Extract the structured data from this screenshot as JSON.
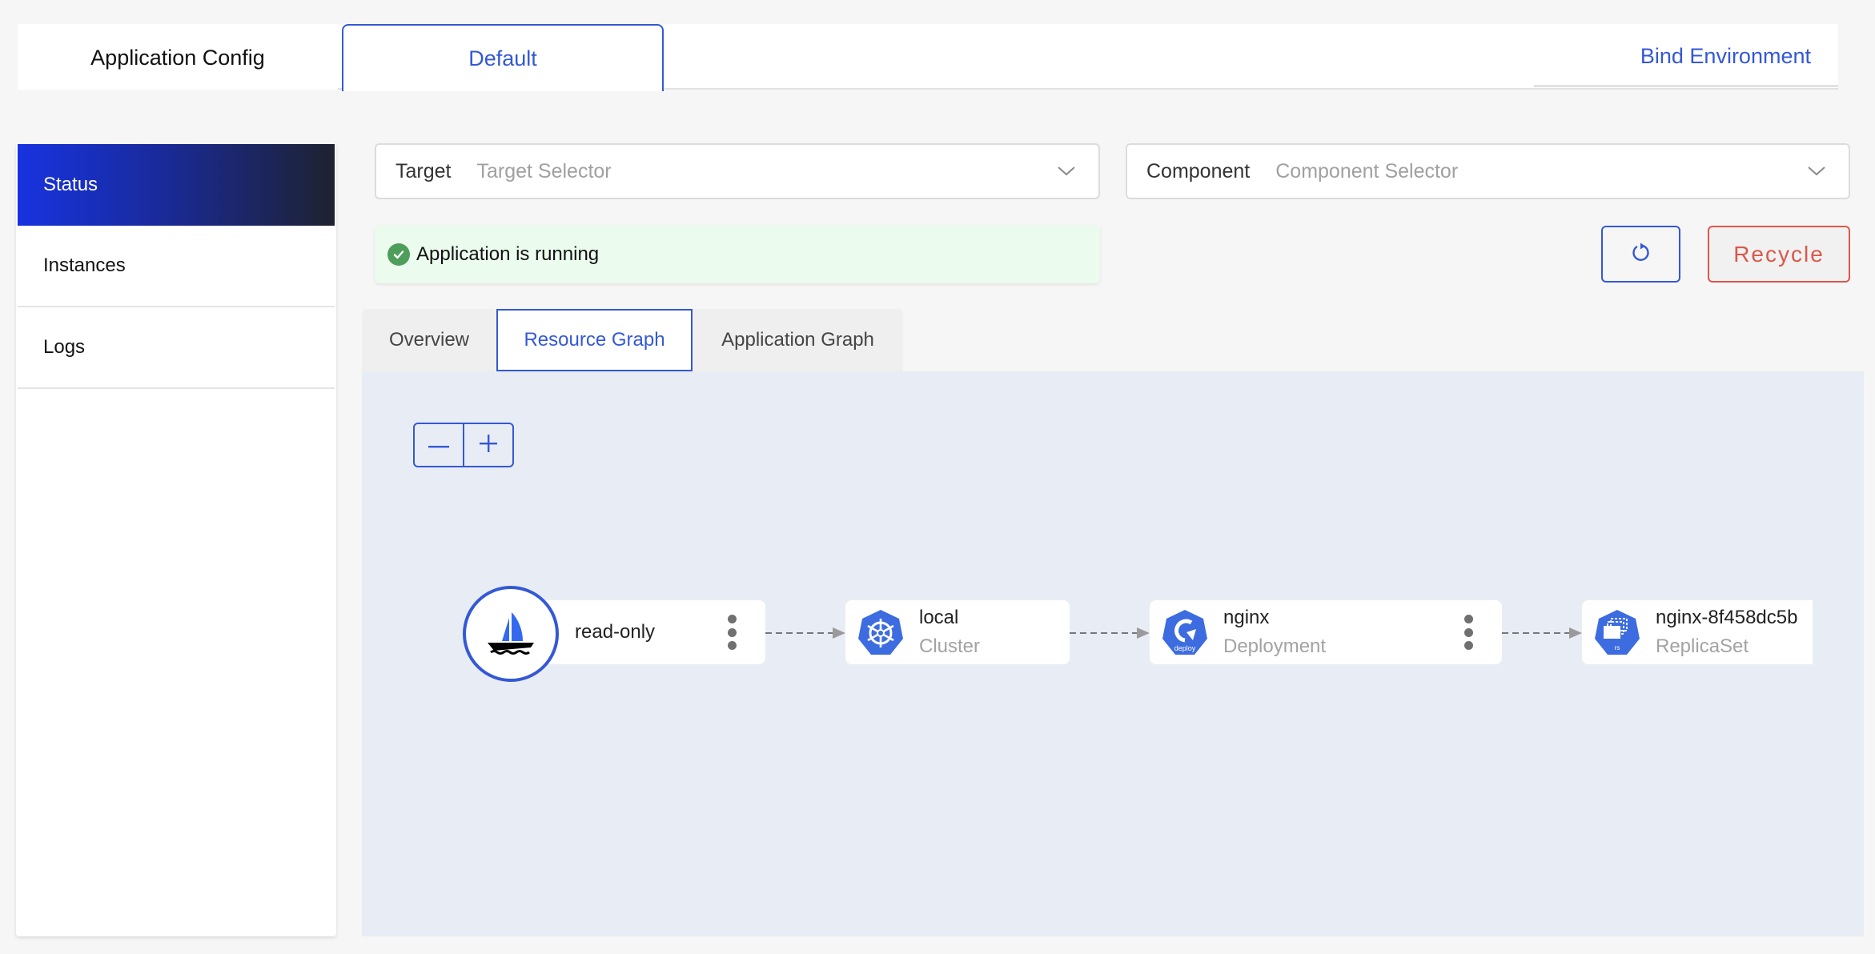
{
  "top_tabs": {
    "app_config": "Application Config",
    "env_tab": "Default",
    "bind_environment": "Bind Environment"
  },
  "sidebar": {
    "items": [
      {
        "label": "Status",
        "active": true
      },
      {
        "label": "Instances",
        "active": false
      },
      {
        "label": "Logs",
        "active": false
      }
    ]
  },
  "selectors": {
    "target": {
      "label": "Target",
      "placeholder": "Target Selector",
      "icon": "chevron-down-icon"
    },
    "component": {
      "label": "Component",
      "placeholder": "Component Selector",
      "icon": "chevron-down-icon"
    }
  },
  "status": {
    "message": "Application is running",
    "icon": "check-circle-icon",
    "color": "#4d9e5a"
  },
  "actions": {
    "refresh_icon": "refresh-icon",
    "recycle_label": "Recycle"
  },
  "inner_tabs": [
    {
      "label": "Overview",
      "active": false
    },
    {
      "label": "Resource Graph",
      "active": true
    },
    {
      "label": "Application Graph",
      "active": false
    }
  ],
  "graph": {
    "zoom_out_icon": "minus-icon",
    "zoom_in_icon": "plus-icon",
    "nodes": [
      {
        "name": "read-only",
        "kind": "",
        "icon": "sailboat-icon",
        "has_menu": true
      },
      {
        "name": "local",
        "kind": "Cluster",
        "icon": "kubernetes-helm-icon",
        "has_menu": false
      },
      {
        "name": "nginx",
        "kind": "Deployment",
        "icon": "k8s-deploy-icon",
        "icon_text": "deploy",
        "has_menu": true
      },
      {
        "name": "nginx-8f458dc5b",
        "kind": "ReplicaSet",
        "icon": "k8s-replicaset-icon",
        "icon_text": "rs",
        "has_menu": false
      }
    ]
  },
  "colors": {
    "accent": "#3458d6",
    "danger": "#d9584b",
    "success_bg": "#ebfbee",
    "canvas_bg": "#e8edf5",
    "k8s_blue": "#3d6ce0"
  }
}
